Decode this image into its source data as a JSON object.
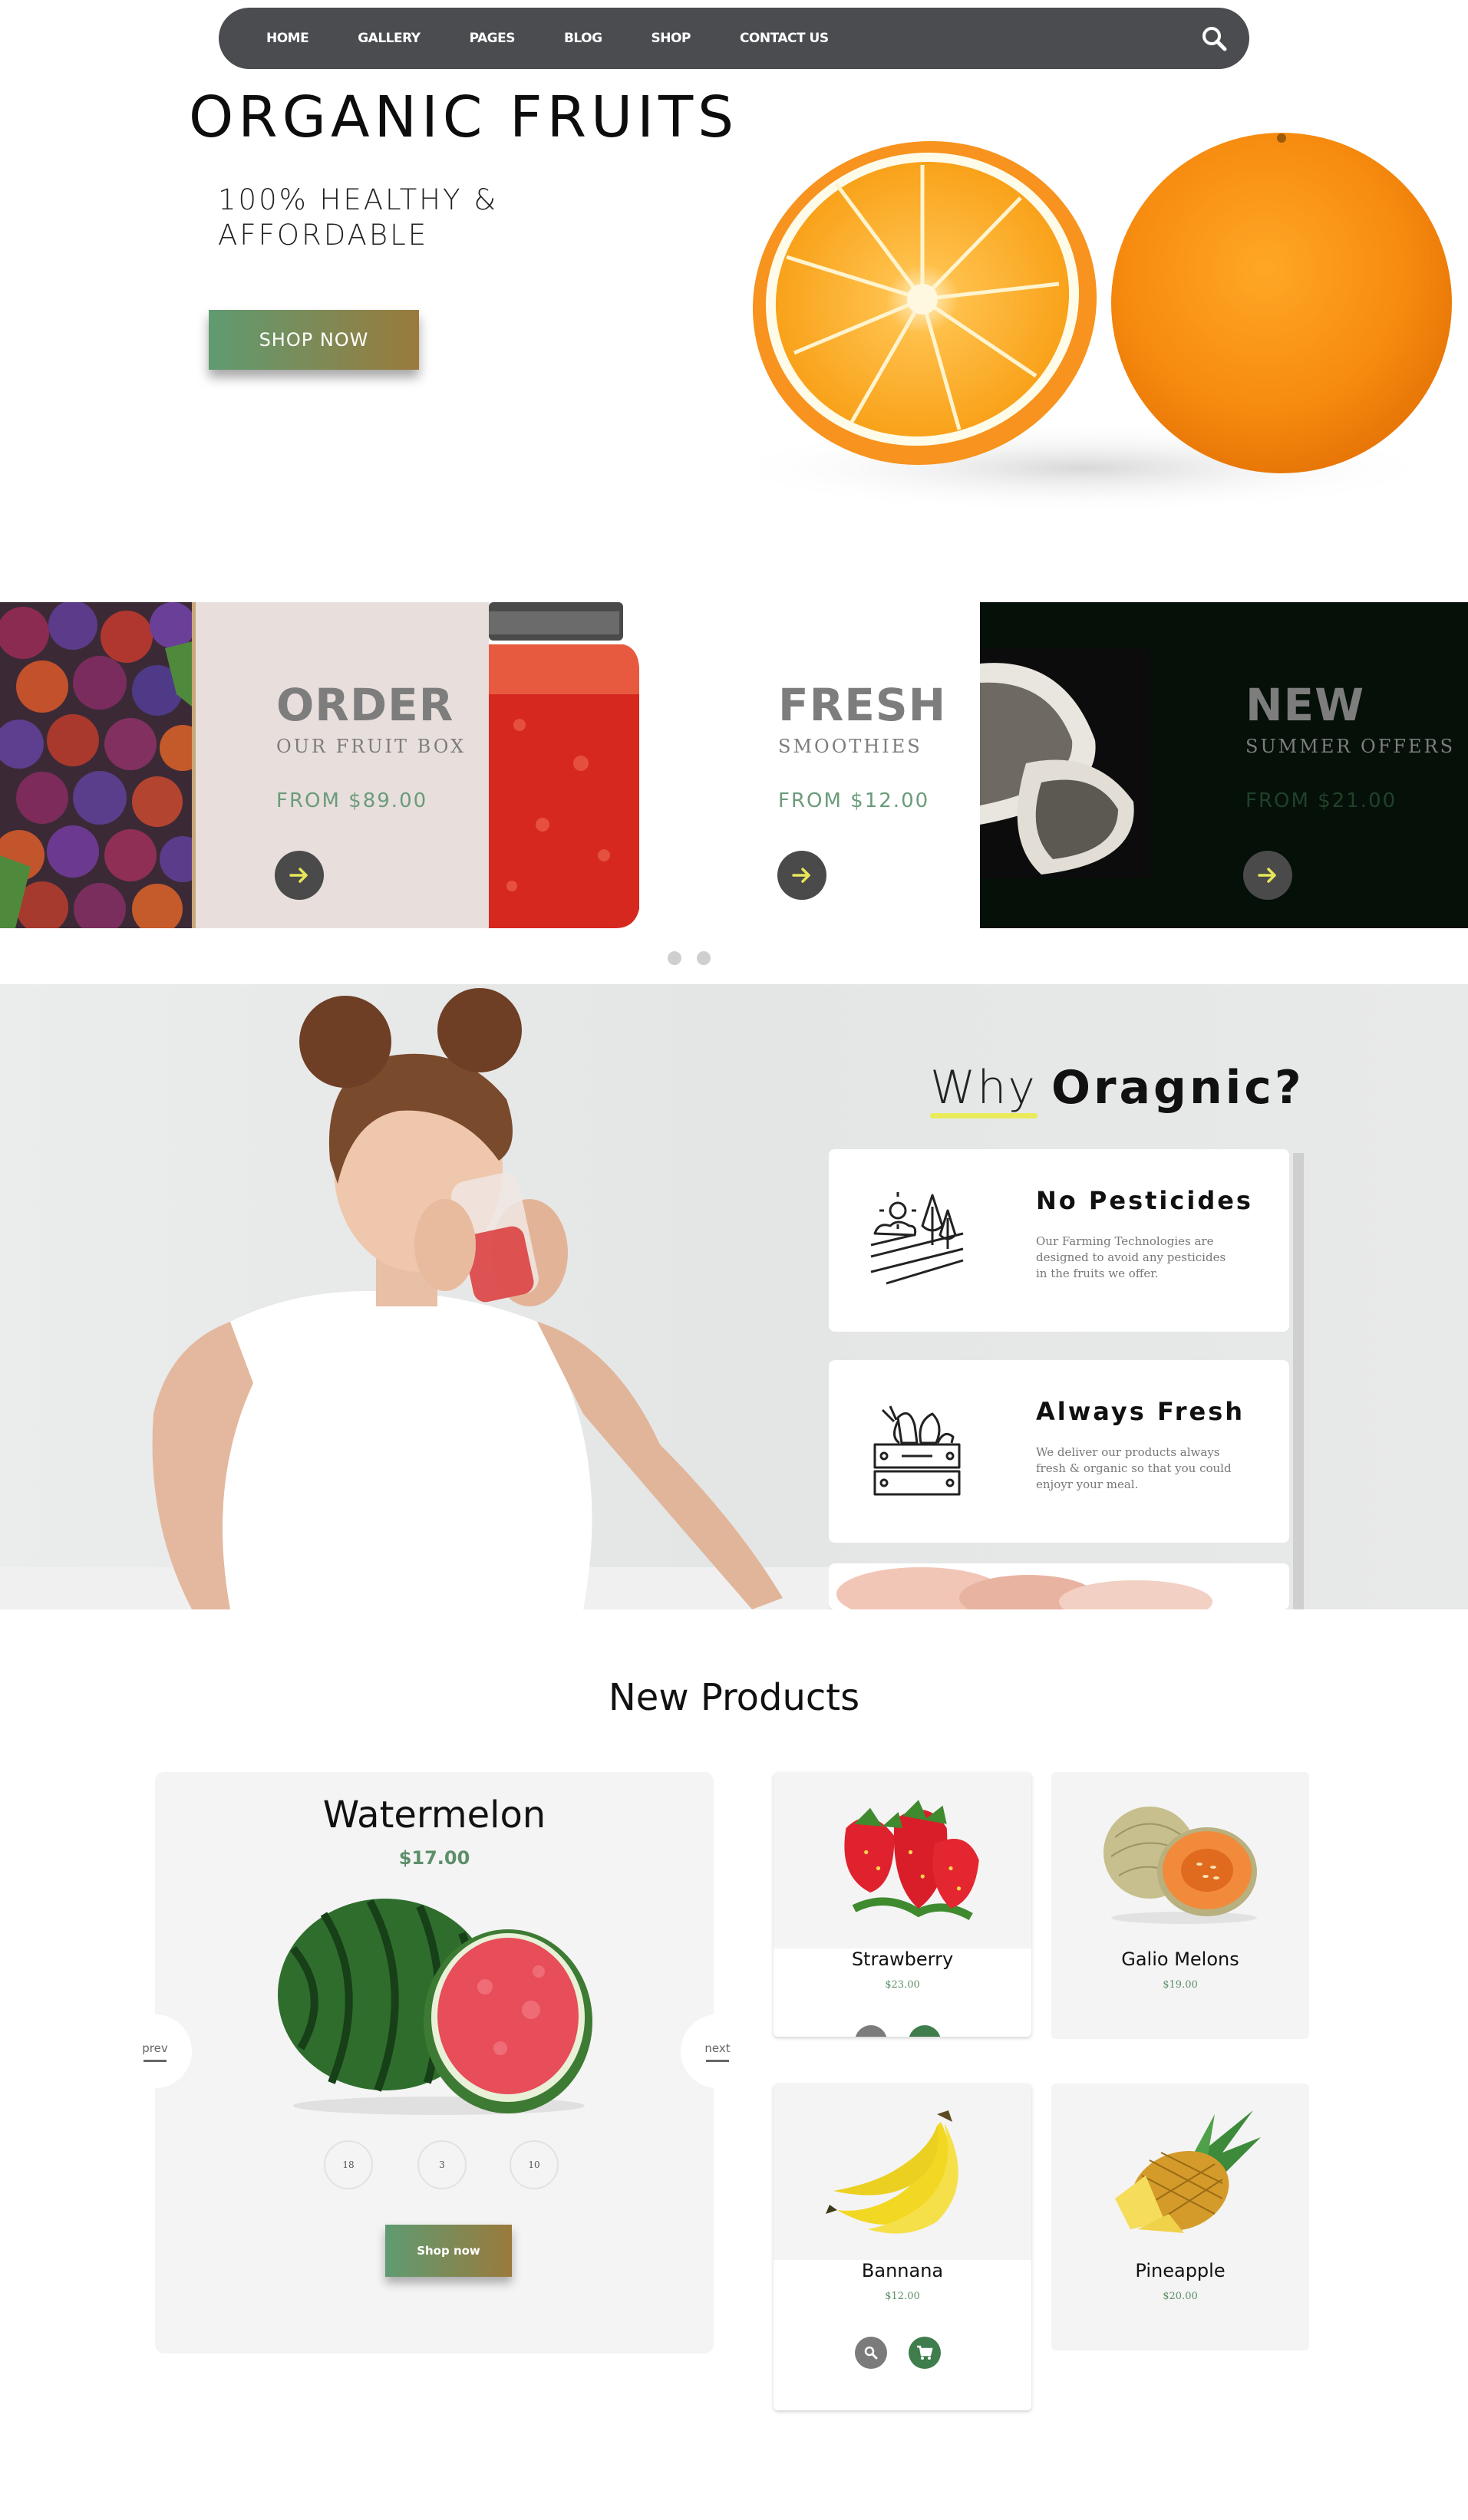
{
  "nav": {
    "links": [
      "HOME",
      "GALLERY",
      "PAGES",
      "BLOG",
      "SHOP",
      "CONTACT US"
    ]
  },
  "hero": {
    "title": "ORGANIC FRUITS",
    "subtitle_line1": "100% HEALTHY &",
    "subtitle_line2": "AFFORDABLE",
    "cta": "SHOP NOW"
  },
  "promos": [
    {
      "title": "ORDER",
      "subtitle": "OUR FRUIT BOX",
      "price": "FROM $89.00"
    },
    {
      "title": "FRESH",
      "subtitle": "SMOOTHIES",
      "price": "FROM $12.00"
    },
    {
      "title": "NEW",
      "subtitle": "SUMMER OFFERS",
      "price": "FROM $21.00"
    }
  ],
  "why": {
    "title_light": "Why",
    "title_bold": "Oragnic?",
    "features": [
      {
        "title": "No Pesticides",
        "desc": "Our Farming Technologies are designed to avoid any pesticides in the fruits we offer."
      },
      {
        "title": "Always Fresh",
        "desc": "We deliver our products always fresh & organic so that you could enjoyr your meal."
      }
    ]
  },
  "new_products": {
    "title": "New Products",
    "featured": {
      "name": "Watermelon",
      "price": "$17.00",
      "prev": "prev",
      "next": "next",
      "counters": [
        "18",
        "3",
        "10"
      ],
      "cta": "Shop now"
    },
    "products": [
      {
        "name": "Strawberry",
        "price": "$23.00"
      },
      {
        "name": "Galio Melons",
        "price": "$19.00"
      },
      {
        "name": "Bannana",
        "price": "$12.00"
      },
      {
        "name": "Pineapple",
        "price": "$20.00"
      }
    ]
  },
  "colors": {
    "nav_bg": "#4a4c4f",
    "accent_green": "#5f9b72",
    "accent_brown": "#9a7a3c",
    "price_green": "#5c8f6a",
    "highlight_yellow": "#eaeb5a"
  },
  "icons": [
    "search-icon",
    "arrow-right-icon",
    "farm-field-icon",
    "fruit-crate-icon",
    "search-small-icon",
    "cart-icon"
  ]
}
